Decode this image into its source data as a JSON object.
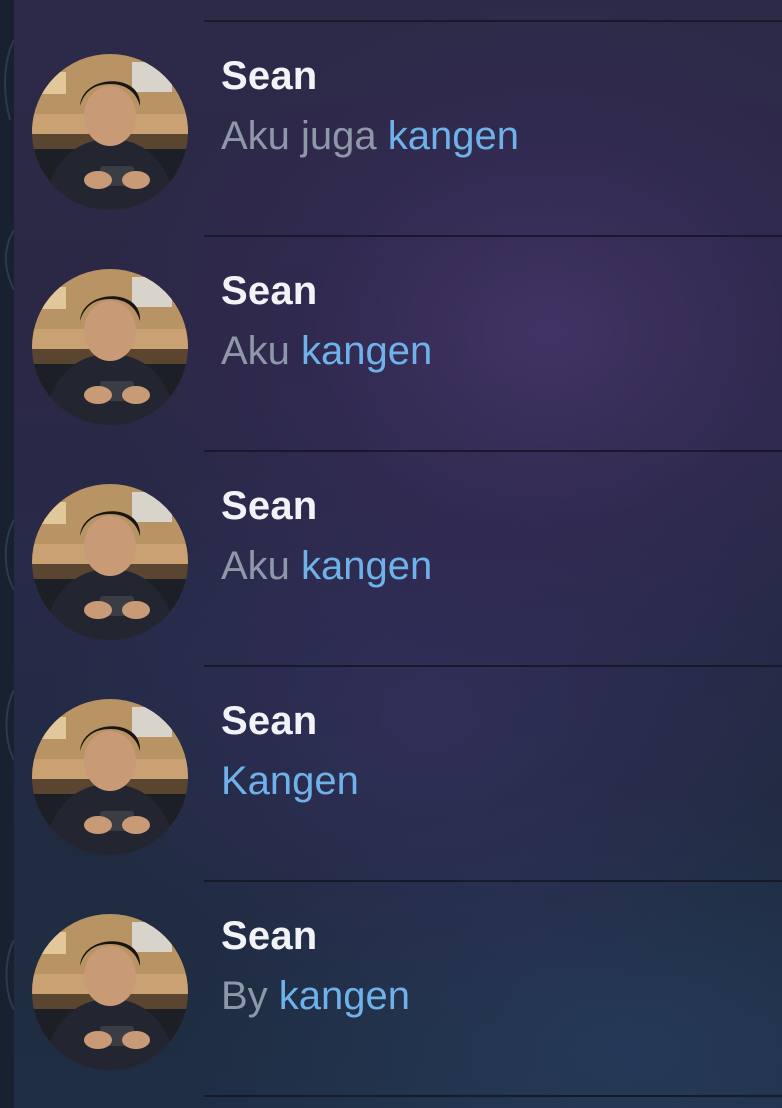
{
  "chats": [
    {
      "name": "Sean",
      "prefix": "Aku juga ",
      "highlight": "kangen",
      "avatar_icon": "contact-photo"
    },
    {
      "name": "Sean",
      "prefix": "Aku ",
      "highlight": "kangen",
      "avatar_icon": "contact-photo"
    },
    {
      "name": "Sean",
      "prefix": "Aku ",
      "highlight": "kangen",
      "avatar_icon": "contact-photo"
    },
    {
      "name": "Sean",
      "prefix": "",
      "highlight": "Kangen",
      "avatar_icon": "contact-photo"
    },
    {
      "name": "Sean",
      "prefix": "By ",
      "highlight": "kangen",
      "avatar_icon": "contact-photo"
    }
  ],
  "colors": {
    "name_text": "#f2f3f7",
    "preview_text": "#8e98a8",
    "highlight_text": "#6fb2ea",
    "divider": "#141824"
  }
}
